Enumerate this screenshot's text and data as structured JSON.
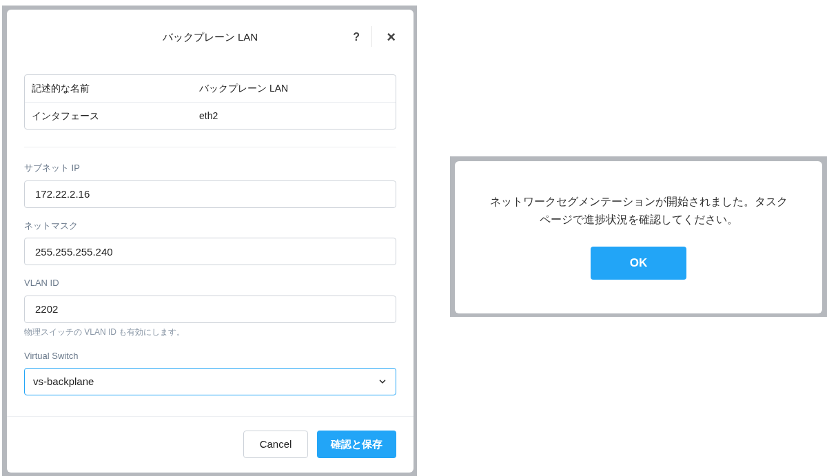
{
  "network_dialog": {
    "title": "バックプレーン LAN",
    "help": "?",
    "close": "×",
    "info_rows": [
      {
        "label": "記述的な名前",
        "value": "バックプレーン LAN"
      },
      {
        "label": "インタフェース",
        "value": "eth2"
      }
    ],
    "fields": [
      {
        "kind": "text",
        "label": "サブネット IP",
        "value": "172.22.2.16"
      },
      {
        "kind": "text",
        "label": "ネットマスク",
        "value": "255.255.255.240"
      },
      {
        "kind": "text",
        "label": "VLAN ID",
        "value": "2202",
        "hint": "物理スイッチの VLAN ID も有効にします。"
      },
      {
        "kind": "select",
        "label": "Virtual Switch",
        "value": "vs-backplane",
        "focused": true
      }
    ],
    "buttons": [
      {
        "label": "Cancel",
        "primary": false
      },
      {
        "label": "確認と保存",
        "primary": true
      }
    ]
  },
  "confirmation_dialog": {
    "message": "ネットワークセグメンテーションが開始されました。タスクページで進捗状況を確認してください。",
    "button": "OK"
  }
}
